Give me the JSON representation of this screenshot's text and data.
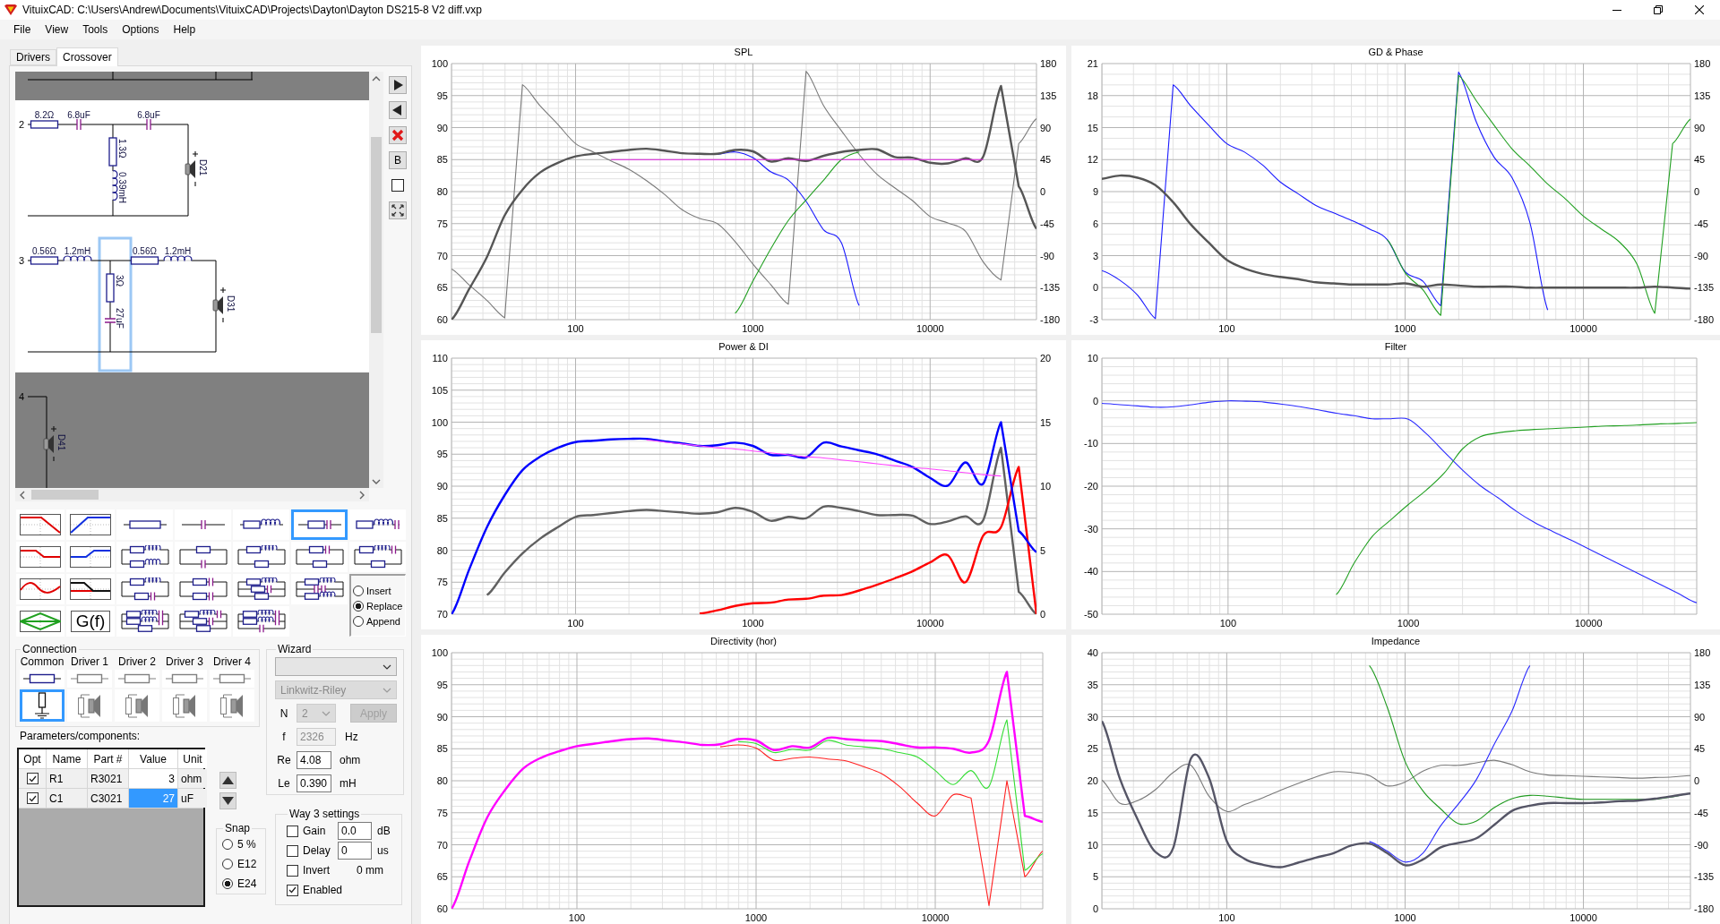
{
  "window": {
    "title": "VituixCAD: C:\\Users\\Andrew\\Documents\\VituixCAD\\Projects\\Dayton\\Dayton DS215-8 V2 diff.vxp"
  },
  "menu": [
    "File",
    "View",
    "Tools",
    "Options",
    "Help"
  ],
  "tabs": [
    {
      "label": "Drivers",
      "selected": false
    },
    {
      "label": "Crossover",
      "selected": true
    }
  ],
  "schematic": {
    "ways": [
      {
        "active": false
      },
      {
        "number": "2",
        "active": true,
        "series": [
          {
            "kind": "resistor",
            "label": "8.2Ω"
          },
          {
            "kind": "capacitor",
            "label": "6.8uF"
          }
        ],
        "shunt": {
          "selected": false,
          "parts": [
            {
              "kind": "resistor",
              "label": "1.3Ω"
            },
            {
              "kind": "inductor",
              "label": "0.39mH"
            }
          ]
        },
        "series_after": [
          {
            "kind": "capacitor",
            "label": "6.8uF"
          }
        ],
        "driver": "D21"
      },
      {
        "number": "3",
        "active": true,
        "series": [
          {
            "kind": "resistor",
            "label": "0.56Ω"
          },
          {
            "kind": "inductor",
            "label": "1.2mH"
          }
        ],
        "shunt": {
          "selected": true,
          "parts": [
            {
              "kind": "resistor",
              "label": "3Ω"
            },
            {
              "kind": "capacitor",
              "label": "27uF"
            }
          ]
        },
        "series_after": [
          {
            "kind": "resistor",
            "label": "0.56Ω"
          },
          {
            "kind": "inductor",
            "label": "1.2mH"
          }
        ],
        "driver": "D31"
      },
      {
        "number": "4",
        "active": false,
        "driver": "D41"
      }
    ]
  },
  "schematic_tools": [
    {
      "kind": "next"
    },
    {
      "kind": "previous"
    },
    {
      "kind": "delete"
    },
    {
      "kind": "text",
      "label": "B"
    },
    {
      "kind": "frame"
    },
    {
      "kind": "fit"
    }
  ],
  "palette": [
    {
      "kind": "lowpass",
      "selected": false
    },
    {
      "kind": "highpass",
      "selected": false
    },
    {
      "kind": "resistor",
      "selected": false
    },
    {
      "kind": "capacitor",
      "selected": false
    },
    {
      "kind": "r_l",
      "selected": false
    },
    {
      "kind": "r_c",
      "selected": true
    },
    {
      "kind": "r_l_c",
      "selected": false
    },
    {
      "kind": "shelf_low",
      "selected": false
    },
    {
      "kind": "shelf_high",
      "selected": false
    },
    {
      "kind": "rl_rl",
      "selected": false
    },
    {
      "kind": "r_c_par",
      "selected": false
    },
    {
      "kind": "rl_r",
      "selected": false
    },
    {
      "kind": "rc_r",
      "selected": false
    },
    {
      "kind": "rlc_r",
      "selected": false
    },
    {
      "kind": "peak",
      "selected": false
    },
    {
      "kind": "xover",
      "selected": false
    },
    {
      "kind": "rl_rc",
      "selected": false
    },
    {
      "kind": "rc_rc",
      "selected": false
    },
    {
      "kind": "rl_rc_r",
      "selected": false
    },
    {
      "kind": "rl_cc_rl",
      "selected": false
    },
    {
      "kind": "allpass",
      "selected": false
    },
    {
      "kind": "gf",
      "label": "G(f)",
      "selected": false
    },
    {
      "kind": "rlc_rlc_r",
      "selected": false
    },
    {
      "kind": "rlc_rc_r",
      "selected": false
    },
    {
      "kind": "rlc_rlc_c",
      "selected": false
    }
  ],
  "placement": [
    {
      "label": "Insert",
      "selected": false
    },
    {
      "label": "Replace",
      "selected": true
    },
    {
      "label": "Append",
      "selected": false
    }
  ],
  "connection": {
    "title": "Connection",
    "columns": [
      {
        "label": "Common",
        "kind": "common",
        "selected": true
      },
      {
        "label": "Driver 1",
        "kind": "driver",
        "selected": false
      },
      {
        "label": "Driver 2",
        "kind": "driver",
        "selected": false
      },
      {
        "label": "Driver 3",
        "kind": "driver",
        "selected": false
      },
      {
        "label": "Driver 4",
        "kind": "driver",
        "selected": false
      }
    ]
  },
  "parameters": {
    "title": "Parameters/components:",
    "columns": [
      "Opt",
      "Name",
      "Part #",
      "Value",
      "Unit"
    ],
    "rows": [
      {
        "checked": true,
        "name": "R1",
        "part": "R3021",
        "value": "3",
        "unit": "ohm",
        "selected": false
      },
      {
        "checked": true,
        "name": "C1",
        "part": "C3021",
        "value": "27",
        "unit": "uF",
        "selected": true
      }
    ]
  },
  "snap": {
    "title": "Snap",
    "options": [
      {
        "label": "5 %",
        "selected": false
      },
      {
        "label": "E12",
        "selected": false
      },
      {
        "label": "E24",
        "selected": true
      }
    ]
  },
  "wizard": {
    "title": "Wizard",
    "type_select": {
      "disabled": false
    },
    "filter_select": {
      "value": "Linkwitz-Riley",
      "disabled": true
    },
    "order": {
      "label": "N",
      "value": "2",
      "disabled": true
    },
    "apply": {
      "label": "Apply",
      "disabled": true
    },
    "fields": [
      {
        "label": "f",
        "value": "2326",
        "unit": "Hz",
        "disabled": true
      },
      {
        "label": "Re",
        "value": "4.08",
        "unit": "ohm",
        "disabled": false
      },
      {
        "label": "Le",
        "value": "0.390",
        "unit": "mH",
        "disabled": false
      }
    ]
  },
  "way_settings": {
    "title": "Way 3 settings",
    "rows": [
      {
        "label": "Gain",
        "checked": false,
        "value": "0.0",
        "unit": "dB"
      },
      {
        "label": "Delay",
        "checked": false,
        "value": "0",
        "unit": "us"
      },
      {
        "label": "Invert",
        "checked": false,
        "note": "0 mm"
      },
      {
        "label": "Enabled",
        "checked": true
      }
    ]
  },
  "charts": [
    {
      "right_ticks": [
        "180",
        "135",
        "90",
        "45",
        "0",
        "-45",
        "-90",
        "-135",
        "-180"
      ],
      "chart_data": {
        "type": "line",
        "title": "SPL",
        "grid": true,
        "ylim": [
          60,
          100
        ],
        "yticks": [
          100,
          95,
          90,
          85,
          80,
          75,
          70,
          65,
          60
        ],
        "categories": [
          null,
          null,
          null,
          null,
          null,
          null,
          null,
          "100",
          null,
          null,
          null,
          null,
          null,
          null,
          null,
          null,
          null,
          "1000",
          null,
          null,
          null,
          null,
          null,
          null,
          null,
          null,
          null,
          "10000",
          null,
          null,
          null,
          null,
          null,
          null
        ],
        "series": [
          {
            "color": "#7a7a7a",
            "values": [
              67.9,
              65.4,
              63,
              60.3,
              96.7,
              93.4,
              90.5,
              87.5,
              86.2,
              84.8,
              83.5,
              81.7,
              79.6,
              77.2,
              75.8,
              75,
              72.2,
              68.7,
              65.5,
              62.4,
              98.8,
              93.4,
              89.5,
              85.8,
              82.7,
              80.6,
              78.6,
              76.1,
              75.1,
              73.8,
              69,
              66.2,
              87.5,
              91.4
            ]
          },
          {
            "color": "#1a1aff",
            "values": [
              null,
              null,
              null,
              null,
              null,
              null,
              null,
              null,
              null,
              null,
              null,
              null,
              null,
              null,
              null,
              85.8,
              86.2,
              85.3,
              83.1,
              81.8,
              78.5,
              74,
              72,
              62.2,
              null,
              null,
              null,
              null,
              null,
              null,
              null,
              null,
              null,
              null
            ]
          },
          {
            "color": "#22a022",
            "values": [
              null,
              null,
              null,
              null,
              null,
              null,
              null,
              null,
              null,
              null,
              null,
              null,
              null,
              null,
              null,
              null,
              61,
              66,
              71,
              75.5,
              78.7,
              81.8,
              85,
              86.2,
              null,
              null,
              null,
              null,
              null,
              null,
              null,
              null,
              null,
              null
            ]
          },
          {
            "color": "#555555",
            "values": [
              60,
              64.8,
              69.8,
              76.3,
              80.3,
              83,
              84.5,
              85.5,
              85.9,
              86.2,
              86.5,
              86.7,
              86.4,
              86,
              85.9,
              85.9,
              86.5,
              86.3,
              84.7,
              85.2,
              84.8,
              85.6,
              86.2,
              86.5,
              86.6,
              85.4,
              85.3,
              84.5,
              84.4,
              85.2,
              85.5,
              96.5,
              80.8,
              74.2
            ]
          },
          {
            "color": "#e020e0",
            "values": [
              null,
              null,
              null,
              null,
              null,
              null,
              null,
              null,
              null,
              85,
              85,
              85,
              85,
              85,
              85,
              85,
              85,
              85,
              85,
              85,
              85,
              85,
              85,
              85,
              85,
              85,
              85,
              85,
              85,
              85,
              85,
              null,
              null,
              null
            ]
          }
        ]
      }
    },
    {
      "right_ticks": [
        "180",
        "135",
        "90",
        "45",
        "0",
        "-45",
        "-90",
        "-135",
        "-180"
      ],
      "chart_data": {
        "type": "line",
        "title": "GD & Phase",
        "grid": true,
        "ylim": [
          -3,
          21
        ],
        "yticks": [
          21,
          18,
          15,
          12,
          9,
          6,
          3,
          0,
          -3
        ],
        "categories": [
          null,
          null,
          null,
          null,
          null,
          null,
          null,
          "100",
          null,
          null,
          null,
          null,
          null,
          null,
          null,
          null,
          null,
          "1000",
          null,
          null,
          null,
          null,
          null,
          null,
          null,
          null,
          null,
          "10000",
          null,
          null,
          null,
          null,
          null,
          null
        ],
        "series": [
          {
            "color": "#1a1aff",
            "values": [
              1.6,
              0.7,
              -0.7,
              -2.9,
              19,
              17,
              15.2,
              13.5,
              12.7,
              11.5,
              9.9,
              8.8,
              7.7,
              7,
              6.3,
              5.5,
              4.5,
              1.5,
              0.6,
              -1.7,
              20.2,
              15.5,
              12.2,
              10.3,
              6.1,
              -2.1,
              null,
              null,
              null,
              null,
              null,
              null,
              null,
              null
            ]
          },
          {
            "color": "#22a022",
            "values": [
              null,
              null,
              null,
              null,
              null,
              null,
              null,
              null,
              null,
              null,
              null,
              null,
              null,
              null,
              null,
              null,
              4.5,
              1.4,
              -0.2,
              -2.6,
              19.9,
              17.5,
              15.2,
              13,
              11.4,
              9.7,
              8.3,
              6.7,
              5.5,
              4.3,
              2.2,
              -2.4,
              13.5,
              15.8
            ]
          },
          {
            "color": "#555555",
            "values": [
              10.2,
              10.5,
              10.3,
              9.6,
              8,
              5.9,
              4.2,
              2.6,
              1.8,
              1.3,
              1,
              0.8,
              0.5,
              0.4,
              0.3,
              0.3,
              0.3,
              0.4,
              0.1,
              0.3,
              0.2,
              0.1,
              0.1,
              0.1,
              0,
              0,
              0,
              0,
              0,
              0,
              0,
              0.1,
              0,
              -0.1
            ]
          }
        ]
      }
    },
    {
      "right_ticks": [
        "20",
        "15",
        "10",
        "5",
        "0"
      ],
      "chart_data": {
        "type": "line",
        "title": "Power & DI",
        "grid": true,
        "ylim": [
          70,
          110
        ],
        "yticks": [
          110,
          105,
          100,
          95,
          90,
          85,
          80,
          75,
          70
        ],
        "categories": [
          null,
          null,
          null,
          null,
          null,
          null,
          null,
          "100",
          null,
          null,
          null,
          null,
          null,
          null,
          null,
          null,
          null,
          "1000",
          null,
          null,
          null,
          null,
          null,
          null,
          null,
          null,
          null,
          "10000",
          null,
          null,
          null,
          null,
          null,
          null
        ],
        "series": [
          {
            "color": "#606060",
            "values": [
              null,
              null,
              73,
              76.5,
              79.5,
              81.8,
              83.6,
              85.2,
              85.5,
              85.8,
              86.1,
              86.3,
              86.1,
              85.9,
              85.7,
              85.9,
              86.6,
              86,
              84.6,
              85.2,
              85,
              86.8,
              86.6,
              86.1,
              85.5,
              85.5,
              85.4,
              84.1,
              84.5,
              85.3,
              84.7,
              96,
              73.5,
              70
            ]
          },
          {
            "color": "#ff0000",
            "values": [
              null,
              null,
              null,
              null,
              null,
              null,
              null,
              null,
              null,
              null,
              null,
              null,
              null,
              null,
              70.1,
              70.6,
              71.3,
              71.7,
              71.8,
              72.3,
              72.4,
              72.9,
              73,
              73.7,
              74.6,
              75.6,
              76.7,
              78.1,
              79.2,
              75,
              82.3,
              83.6,
              93,
              70
            ]
          },
          {
            "color": "#0000ff",
            "values": [
              70,
              77,
              83.6,
              88.6,
              92.5,
              94.6,
              96,
              96.9,
              97.1,
              97.3,
              97.4,
              97.4,
              97,
              96.7,
              96.3,
              96.4,
              96.8,
              96.3,
              94.9,
              94.9,
              94.5,
              96.8,
              96.2,
              95.6,
              95,
              94,
              93,
              91.3,
              90.1,
              93.7,
              90.4,
              100,
              83,
              79.7
            ]
          },
          {
            "color": "#ff44ff",
            "values": [
              null,
              null,
              null,
              null,
              null,
              null,
              null,
              null,
              null,
              null,
              null,
              97.2,
              96.9,
              96.6,
              96.3,
              96,
              95.8,
              95.5,
              95.2,
              94.9,
              94.6,
              94.4,
              94.1,
              93.8,
              93.5,
              93.2,
              92.9,
              92.7,
              92.4,
              92.1,
              91.8,
              91.6,
              null,
              null
            ]
          }
        ]
      }
    },
    {
      "chart_data": {
        "type": "line",
        "title": "Filter",
        "grid": true,
        "ylim": [
          -50,
          10
        ],
        "yticks": [
          10,
          0,
          -10,
          -20,
          -30,
          -40,
          -50
        ],
        "categories": [
          null,
          null,
          null,
          null,
          null,
          null,
          null,
          "100",
          null,
          null,
          null,
          null,
          null,
          null,
          null,
          null,
          null,
          "1000",
          null,
          null,
          null,
          null,
          null,
          null,
          null,
          null,
          null,
          "10000",
          null,
          null,
          null,
          null,
          null,
          null
        ],
        "series": [
          {
            "color": "#2a2aff",
            "values": [
              -0.6,
              -0.9,
              -1.2,
              -1.5,
              -1.4,
              -0.9,
              -0.3,
              0,
              -0.1,
              -0.3,
              -0.8,
              -1.4,
              -2.1,
              -2.9,
              -3.5,
              -4.2,
              -4.2,
              -4.3,
              -7.7,
              -12,
              -16.2,
              -19.9,
              -22.8,
              -25.9,
              -28.5,
              -30.6,
              -32.6,
              -34.7,
              -36.8,
              -38.9,
              -41,
              -43.1,
              -45.2,
              -47.3
            ]
          },
          {
            "color": "#22a022",
            "values": [
              null,
              null,
              null,
              null,
              null,
              null,
              null,
              null,
              null,
              null,
              null,
              null,
              null,
              -45.4,
              -38,
              -31.8,
              -28,
              -24.3,
              -20.9,
              -16.9,
              -11.3,
              -8.4,
              -7.5,
              -7,
              -6.7,
              -6.5,
              -6.3,
              -6.1,
              -5.9,
              -5.8,
              -5.6,
              -5.4,
              -5.3,
              -5.1
            ]
          }
        ]
      }
    },
    {
      "chart_data": {
        "type": "line",
        "title": "Directivity (hor)",
        "grid": true,
        "ylim": [
          60,
          100
        ],
        "yticks": [
          100,
          95,
          90,
          85,
          80,
          75,
          70,
          65,
          60
        ],
        "categories": [
          null,
          null,
          null,
          null,
          null,
          null,
          null,
          "100",
          null,
          null,
          null,
          null,
          null,
          null,
          null,
          null,
          null,
          "1000",
          null,
          null,
          null,
          null,
          null,
          null,
          null,
          null,
          null,
          "10000",
          null,
          null,
          null,
          null,
          null,
          null
        ],
        "series": [
          {
            "color": "#ff2020",
            "values": [
              null,
              null,
              null,
              null,
              null,
              null,
              null,
              null,
              null,
              null,
              null,
              null,
              null,
              null,
              null,
              85.3,
              85.6,
              85.1,
              83.2,
              83.5,
              83.7,
              83.4,
              83.1,
              82.2,
              81.1,
              79.1,
              76.5,
              74.5,
              77.8,
              77.3,
              60.5,
              80,
              65,
              69
            ]
          },
          {
            "color": "#33dd33",
            "values": [
              null,
              null,
              null,
              null,
              null,
              null,
              null,
              null,
              null,
              null,
              null,
              null,
              null,
              null,
              null,
              null,
              86.1,
              85.8,
              84.4,
              84.9,
              84.8,
              86.3,
              85.6,
              85.3,
              85,
              84.4,
              83.7,
              81.6,
              79.4,
              81.6,
              79.1,
              89.5,
              66,
              68.6
            ]
          },
          {
            "color": "#ff00ff",
            "values": [
              60,
              67.5,
              74.3,
              78.6,
              81.9,
              83.6,
              84.6,
              85.4,
              85.8,
              86.2,
              86.5,
              86.6,
              86.3,
              86,
              85.6,
              85.7,
              86.5,
              86.3,
              84.8,
              85.4,
              85.2,
              86.7,
              86.5,
              86.3,
              86.2,
              85.7,
              85.2,
              85.2,
              85,
              84.4,
              86.3,
              97,
              74.5,
              73.6
            ]
          }
        ]
      }
    },
    {
      "right_ticks": [
        "180",
        "135",
        "90",
        "45",
        "0",
        "-45",
        "-90",
        "-135",
        "-180"
      ],
      "chart_data": {
        "type": "line",
        "title": "Impedance",
        "grid": true,
        "ylim": [
          0,
          40
        ],
        "yticks": [
          40,
          35,
          30,
          25,
          20,
          15,
          10,
          5,
          0
        ],
        "categories": [
          null,
          null,
          null,
          null,
          null,
          null,
          null,
          "100",
          null,
          null,
          null,
          null,
          null,
          null,
          null,
          null,
          null,
          "1000",
          null,
          null,
          null,
          null,
          null,
          null,
          null,
          null,
          null,
          "10000",
          null,
          null,
          null,
          null,
          null,
          null
        ],
        "series": [
          {
            "color": "#7a7a7a",
            "values": [
              20.1,
              16.5,
              16.9,
              18.6,
              21.3,
              22.4,
              17.6,
              15.2,
              16.3,
              17.3,
              18.5,
              19.6,
              20.6,
              21.4,
              21.3,
              20.8,
              19.2,
              19.8,
              21.5,
              22.4,
              22.4,
              22.8,
              23.2,
              22.5,
              21.4,
              20.9,
              20.8,
              20.7,
              20.6,
              20.5,
              20.4,
              20.5,
              20.6,
              20.8
            ]
          },
          {
            "color": "#1f9a1f",
            "values": [
              null,
              null,
              null,
              null,
              null,
              null,
              null,
              null,
              null,
              null,
              null,
              null,
              null,
              null,
              null,
              38,
              31.5,
              23,
              18.4,
              15.6,
              13.3,
              13.7,
              15.8,
              17.2,
              17.7,
              17.6,
              17.3,
              17.1,
              17.1,
              17.1,
              17.1,
              17.1,
              17.5,
              18
            ]
          },
          {
            "color": "#2a2aff",
            "values": [
              null,
              null,
              null,
              null,
              null,
              null,
              null,
              null,
              null,
              null,
              null,
              null,
              null,
              null,
              null,
              10.5,
              9,
              7.3,
              8.7,
              13,
              16.4,
              20.2,
              25.7,
              30.9,
              38,
              null,
              null,
              null,
              null,
              null,
              null,
              null,
              null,
              null
            ]
          },
          {
            "color": "#555566",
            "values": [
              29.3,
              20.4,
              14,
              8.9,
              9.5,
              23.5,
              20.5,
              10.6,
              7.8,
              6.9,
              6.5,
              7.2,
              8,
              8.7,
              9.9,
              10.2,
              8.7,
              6.8,
              7.7,
              9.6,
              10.3,
              11,
              13.1,
              15.3,
              16.1,
              16.5,
              16.5,
              16.5,
              16.6,
              16.8,
              16.9,
              17.2,
              17.6,
              18
            ]
          }
        ]
      }
    }
  ]
}
